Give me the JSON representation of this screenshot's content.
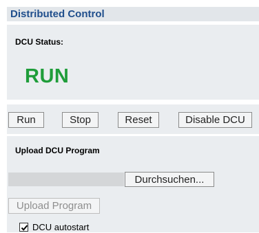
{
  "header": {
    "title": "Distributed Control"
  },
  "status": {
    "label": "DCU Status:",
    "value": "RUN",
    "value_color": "#1f9d3a"
  },
  "controls": {
    "run_label": "Run",
    "stop_label": "Stop",
    "reset_label": "Reset",
    "disable_label": "Disable DCU"
  },
  "upload": {
    "heading": "Upload DCU Program",
    "file_value": "",
    "browse_label": "Durchsuchen...",
    "upload_label": "Upload Program",
    "upload_enabled": false
  },
  "autostart": {
    "label": "DCU autostart",
    "checked": true
  },
  "colors": {
    "header_text": "#1f4e8c",
    "panel_bg": "#eaedf0",
    "header_bg": "#e2e6ea"
  }
}
